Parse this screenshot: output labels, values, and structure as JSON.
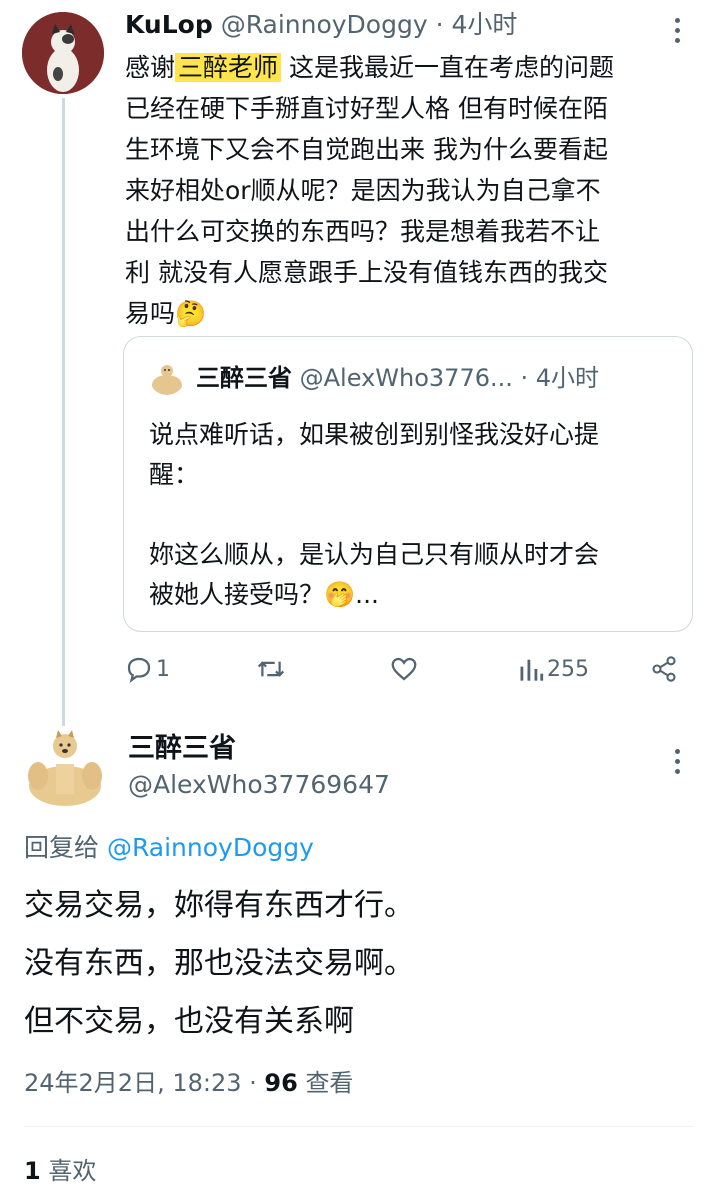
{
  "reply_tweet": {
    "author_name": "KuLop",
    "author_handle": "@RainnoyDoggy",
    "time_ago": "· 4小时",
    "text_before_mention": "感谢",
    "mention": "三醉老师",
    "text_after": "这是我最近一直在考虑的问题\n已经在硬下手掰直讨好型人格 但有时候在陌\n生环境下又会不自觉跑出来 我为什么要看起\n来好相处or顺从呢？是因为我认为自己拿不\n出什么可交换的东西吗？我是想着我若不让\n利 就没有人愿意跟手上没有值钱东西的我交\n易吗",
    "emoji": "🤔",
    "quoted_tweet": {
      "author_name": "三醉三省",
      "author_handle": "@AlexWho3776...",
      "time_ago": "· 4小时",
      "text": "说点难听话，如果被创到别怪我没好心提\n醒：\n\n妳这么顺从，是认为自己只有顺从时才会\n被她人接受吗？",
      "emoji": "🤭",
      "ellipsis": "..."
    },
    "actions": {
      "reply_count": "1",
      "retweet_count": "",
      "like_count": "",
      "view_count": "255"
    }
  },
  "main_tweet": {
    "author_name": "三醉三省",
    "author_handle": "@AlexWho37769647",
    "reply_to_label": "回复给",
    "reply_to_handle": "@RainnoyDoggy",
    "text": "交易交易，妳得有东西才行。\n没有东西，那也没法交易啊。\n但不交易，也没有关系啊",
    "timestamp": "24年2月2日, 18:23 · ",
    "views_number": "96",
    "views_label": "查看",
    "likes_number": "1",
    "likes_label": "喜欢"
  }
}
